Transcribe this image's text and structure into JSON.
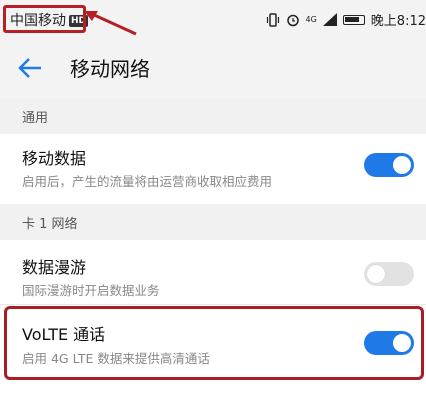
{
  "status_bar": {
    "carrier": "中国移动",
    "hd_badge": "HD",
    "signal_label": "4G",
    "time": "晚上8:12",
    "highlight_color": "#b52025"
  },
  "app_bar": {
    "title": "移动网络",
    "back_icon": "back-arrow-icon"
  },
  "sections": {
    "general": {
      "header": "通用"
    },
    "card1": {
      "header": "卡 1 网络"
    }
  },
  "items": {
    "mobile_data": {
      "title": "移动数据",
      "subtitle": "启用后，产生的流量将由运营商收取相应费用",
      "enabled": true
    },
    "data_roaming": {
      "title": "数据漫游",
      "subtitle": "国际漫游时开启数据业务",
      "enabled": false
    },
    "volte": {
      "title": "VoLTE 通话",
      "subtitle": "启用 4G LTE 数据来提供高清通话",
      "enabled": true
    }
  },
  "colors": {
    "toggle_on": "#1f7ae8",
    "toggle_off": "#e2e2e2",
    "annotation": "#a81d26"
  }
}
